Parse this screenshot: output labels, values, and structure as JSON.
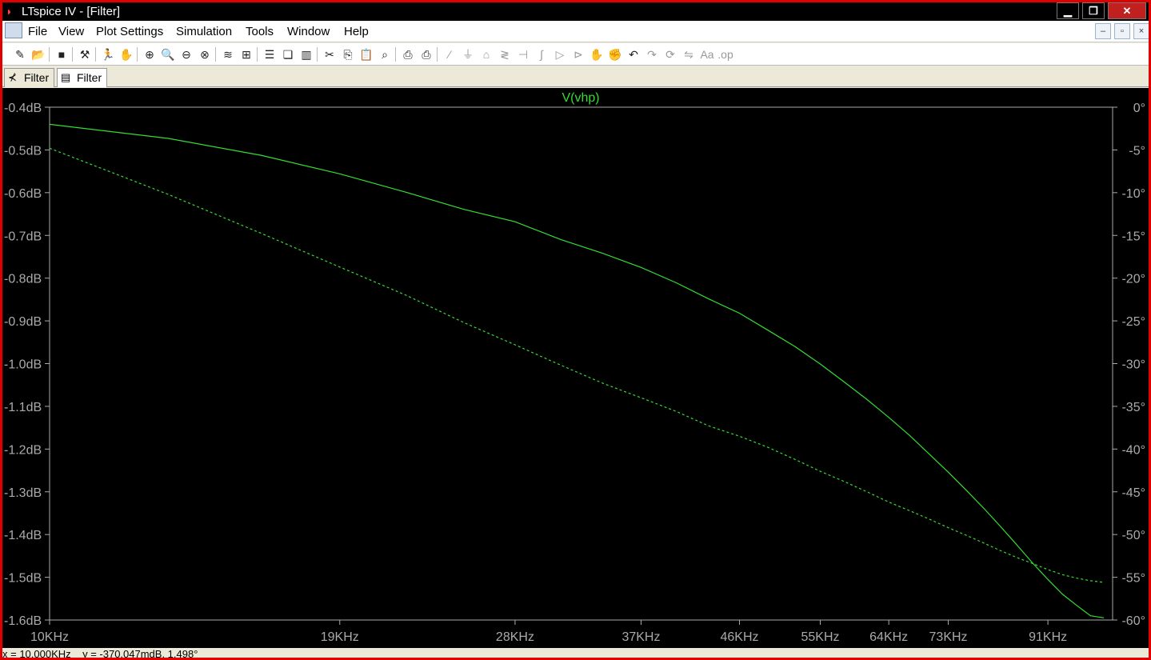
{
  "window": {
    "title": "LTspice IV - [Filter]",
    "controls": {
      "minimize": "▁",
      "restore": "❐",
      "close": "✕"
    }
  },
  "menu": {
    "items": [
      "File",
      "View",
      "Plot Settings",
      "Simulation",
      "Tools",
      "Window",
      "Help"
    ],
    "mdi_controls": {
      "minimize": "–",
      "restore": "▫",
      "close": "×"
    }
  },
  "toolbar": {
    "groups": [
      [
        "new-schematic-icon",
        "open-icon"
      ],
      [
        "save-icon"
      ],
      [
        "hammer-icon"
      ],
      [
        "run-icon",
        "pan-hand-icon"
      ],
      [
        "zoom-in-icon",
        "zoom-area-icon",
        "zoom-out-icon",
        "zoom-cancel-icon"
      ],
      [
        "autorange-icon",
        "fit-icon"
      ],
      [
        "tile-horizontal-icon",
        "cascade-icon",
        "tile-vertical-icon"
      ],
      [
        "cut-icon",
        "copy-icon",
        "paste-icon",
        "find-icon"
      ],
      [
        "print-preview-icon",
        "print-icon"
      ],
      [
        "wire-icon",
        "ground-icon",
        "label-icon",
        "resistor-icon",
        "capacitor-icon",
        "inductor-icon",
        "diode-icon",
        "component-icon",
        "move-icon",
        "drag-icon",
        "undo-icon",
        "redo-icon",
        "rotate-icon",
        "mirror-icon",
        "text-icon",
        "spice-directive-icon"
      ]
    ],
    "active_icons": [
      "new-schematic-icon",
      "open-icon",
      "save-icon",
      "hammer-icon",
      "run-icon",
      "zoom-in-icon",
      "zoom-area-icon",
      "zoom-out-icon",
      "zoom-cancel-icon",
      "autorange-icon",
      "fit-icon",
      "tile-horizontal-icon",
      "cascade-icon",
      "tile-vertical-icon",
      "cut-icon",
      "copy-icon",
      "paste-icon",
      "find-icon",
      "print-preview-icon",
      "print-icon",
      "undo-icon"
    ]
  },
  "tabs": [
    {
      "label": "Filter",
      "icon": "schematic-icon",
      "active": false
    },
    {
      "label": "Filter",
      "icon": "waveform-icon",
      "active": true
    }
  ],
  "status": {
    "text": "x = 10.000KHz    y = -370.047mdB, 1.498°"
  },
  "colors": {
    "trace": "#33dd33",
    "background": "#000000",
    "axis": "#aaaaaa",
    "frame_border": "#e00000"
  },
  "chart_data": {
    "type": "line",
    "title": "V(vhp)",
    "x_scale": "log",
    "xlim": [
      10000,
      105000
    ],
    "x_tick_values": [
      10000,
      19000,
      28000,
      37000,
      46000,
      55000,
      64000,
      73000,
      91000
    ],
    "x_tick_labels": [
      "10KHz",
      "19KHz",
      "28KHz",
      "37KHz",
      "46KHz",
      "55KHz",
      "64KHz",
      "73KHz",
      "91KHz"
    ],
    "y_left": {
      "ylim": [
        -1.6,
        -0.4
      ],
      "tick_values": [
        -0.4,
        -0.5,
        -0.6,
        -0.7,
        -0.8,
        -0.9,
        -1.0,
        -1.1,
        -1.2,
        -1.3,
        -1.4,
        -1.5,
        -1.6
      ],
      "tick_labels": [
        "-0.4dB",
        "-0.5dB",
        "-0.6dB",
        "-0.7dB",
        "-0.8dB",
        "-0.9dB",
        "-1.0dB",
        "-1.1dB",
        "-1.2dB",
        "-1.3dB",
        "-1.4dB",
        "-1.5dB",
        "-1.6dB"
      ]
    },
    "y_right": {
      "ylim": [
        -60,
        0
      ],
      "tick_values": [
        0,
        -5,
        -10,
        -15,
        -20,
        -25,
        -30,
        -35,
        -40,
        -45,
        -50,
        -55,
        -60
      ],
      "tick_labels": [
        "0°",
        "-5°",
        "-10°",
        "-15°",
        "-20°",
        "-25°",
        "-30°",
        "-35°",
        "-40°",
        "-45°",
        "-50°",
        "-55°",
        "-60°"
      ]
    },
    "grid": false,
    "series": [
      {
        "name": "V(vhp)",
        "style": "solid",
        "axis": "left",
        "x": [
          10000,
          13000,
          16000,
          19000,
          22000,
          25000,
          28000,
          31000,
          34000,
          37000,
          40000,
          43000,
          46000,
          49000,
          52000,
          55000,
          58000,
          61000,
          64000,
          67000,
          70000,
          73000,
          76000,
          79000,
          82000,
          85000,
          88000,
          91000,
          94000,
          97000,
          100000,
          103000
        ],
        "y": [
          -0.44,
          -0.473,
          -0.513,
          -0.556,
          -0.599,
          -0.639,
          -0.668,
          -0.71,
          -0.742,
          -0.775,
          -0.811,
          -0.849,
          -0.882,
          -0.922,
          -0.96,
          -1.001,
          -1.043,
          -1.084,
          -1.126,
          -1.168,
          -1.212,
          -1.254,
          -1.297,
          -1.339,
          -1.382,
          -1.425,
          -1.467,
          -1.505,
          -1.54,
          -1.566,
          -1.59,
          -1.595
        ]
      },
      {
        "name": "",
        "style": "dashed",
        "axis": "right",
        "x": [
          10000,
          13000,
          16000,
          19000,
          22000,
          25000,
          28000,
          31000,
          34000,
          37000,
          40000,
          43000,
          46000,
          49000,
          52000,
          55000,
          58000,
          61000,
          64000,
          67000,
          70000,
          73000,
          76000,
          79000,
          82000,
          85000,
          88000,
          91000,
          94000,
          97000,
          100000,
          103000
        ],
        "y": [
          -4.8,
          -10.2,
          -14.8,
          -18.7,
          -22.0,
          -25.2,
          -27.8,
          -30.2,
          -32.3,
          -34.0,
          -35.6,
          -37.3,
          -38.5,
          -39.8,
          -41.2,
          -42.6,
          -43.8,
          -45.0,
          -46.2,
          -47.2,
          -48.2,
          -49.2,
          -50.1,
          -51.0,
          -51.9,
          -52.7,
          -53.4,
          -54.1,
          -54.7,
          -55.1,
          -55.4,
          -55.6
        ]
      }
    ]
  }
}
